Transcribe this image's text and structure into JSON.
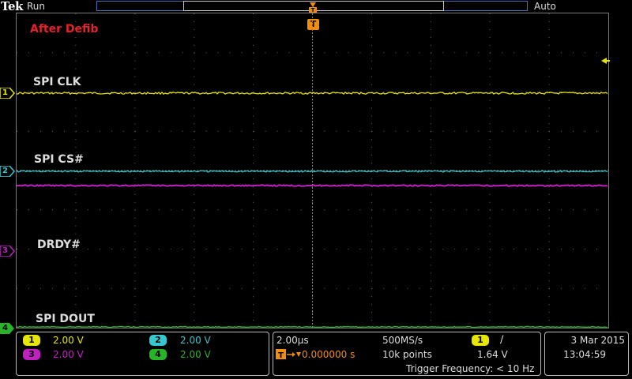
{
  "header": {
    "brand": "Tek",
    "acquisition_state": "Run",
    "trigger_mode": "Auto"
  },
  "screen": {
    "annotation": "After Defib",
    "channels": [
      {
        "id": "1",
        "label": "SPI CLK",
        "color": "#e6e600"
      },
      {
        "id": "2",
        "label": "SPI CS#",
        "color": "#36c8d0"
      },
      {
        "id": "3",
        "label": "DRDY#",
        "color": "#c020c0"
      },
      {
        "id": "4",
        "label": "SPI DOUT",
        "color": "#28b428"
      }
    ],
    "trigger_marker": "T"
  },
  "readout": {
    "vertical": [
      {
        "id": "1",
        "scale": "2.00 V",
        "color": "#e6e600"
      },
      {
        "id": "2",
        "scale": "2.00 V",
        "color": "#36c8d0"
      },
      {
        "id": "3",
        "scale": "2.00 V",
        "color": "#c020c0"
      },
      {
        "id": "4",
        "scale": "2.00 V",
        "color": "#28b428"
      }
    ],
    "horizontal": {
      "time_per_div": "2.00µs",
      "sample_rate": "500MS/s",
      "delay": "0.000000 s",
      "record_length": "10k points",
      "trigger_source": "1",
      "trigger_slope": "∕",
      "trigger_level": "1.64 V",
      "trigger_frequency": "Trigger Frequency: < 10 Hz"
    },
    "date": "3 Mar  2015",
    "time": "13:04:59"
  }
}
